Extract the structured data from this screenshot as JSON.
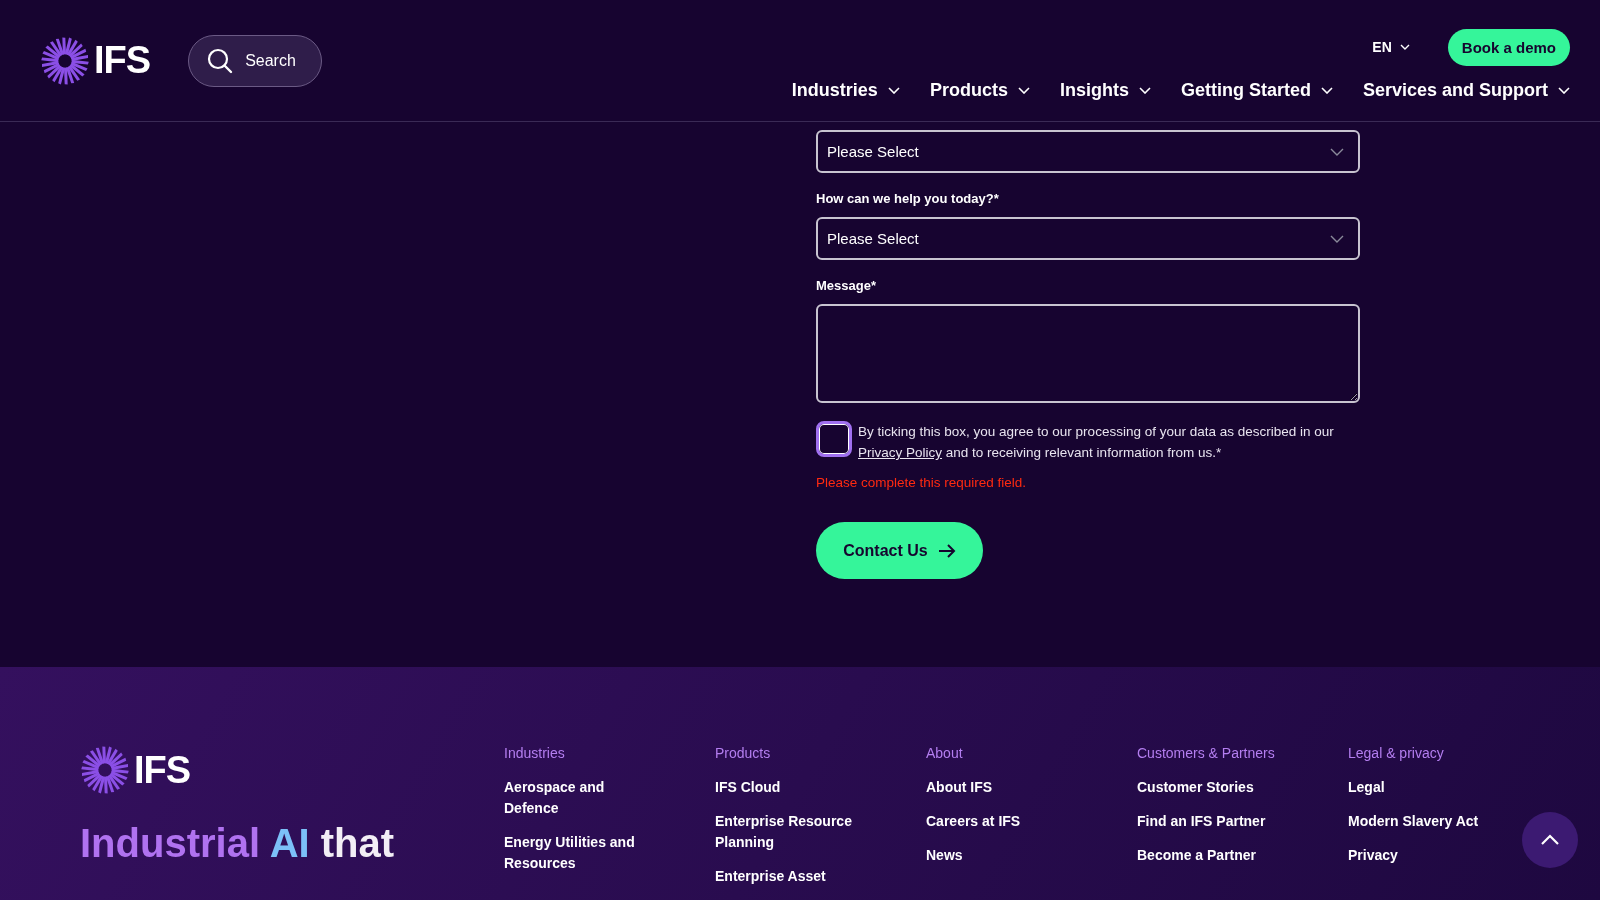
{
  "header": {
    "logo": "IFS",
    "search": {
      "placeholder": "Search"
    },
    "language": "EN",
    "cta": "Book a demo",
    "nav": [
      {
        "label": "Industries"
      },
      {
        "label": "Products"
      },
      {
        "label": "Insights"
      },
      {
        "label": "Getting Started"
      },
      {
        "label": "Services and Support"
      }
    ]
  },
  "form": {
    "fields": [
      {
        "kind": "select",
        "value": "Please Select"
      },
      {
        "kind": "select",
        "label": "How can we help you today?*",
        "value": "Please Select"
      },
      {
        "kind": "textarea",
        "label": "Message*"
      }
    ],
    "consent": {
      "checked": false,
      "before": "By ticking this box, you agree to our processing of your data as described in our",
      "link": "Privacy Policy",
      "after": "and to receiving relevant information from us.*"
    },
    "error": "Please complete this required field.",
    "submit": "Contact Us"
  },
  "footer": {
    "logo": "IFS",
    "headline": [
      {
        "text": "Industrial",
        "kind": "accent"
      },
      {
        "text": "AI",
        "kind": "highlight"
      },
      {
        "text": "that",
        "kind": "plain"
      }
    ],
    "columns": [
      {
        "heading": "Industries",
        "links": [
          "Aerospace and Defence",
          "Energy Utilities and Resources"
        ]
      },
      {
        "heading": "Products",
        "links": [
          "IFS Cloud",
          "Enterprise Resource Planning",
          "Enterprise Asset"
        ]
      },
      {
        "heading": "About",
        "links": [
          "About IFS",
          "Careers at IFS",
          "News"
        ]
      },
      {
        "heading": "Customers & Partners",
        "links": [
          "Customer Stories",
          "Find an IFS Partner",
          "Become a Partner"
        ]
      },
      {
        "heading": "Legal & privacy",
        "links": [
          "Legal",
          "Modern Slavery Act",
          "Privacy"
        ]
      }
    ]
  }
}
